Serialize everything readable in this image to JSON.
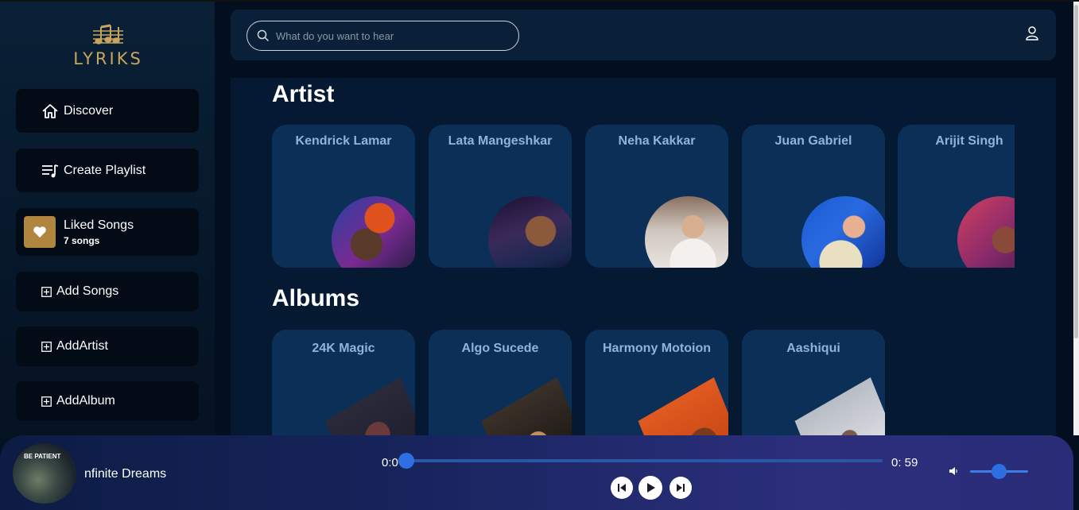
{
  "app": {
    "logo_text": "LYRIKS"
  },
  "sidebar": {
    "discover": "Discover",
    "create_playlist": "Create Playlist",
    "liked_title": "Liked Songs",
    "liked_count": "7 songs",
    "add_songs": "Add Songs",
    "add_artist": "AddArtist",
    "add_album": "AddAlbum"
  },
  "search": {
    "placeholder": "What do you want to hear"
  },
  "artists_section": {
    "title": "Artist",
    "items": [
      {
        "name": "Kendrick Lamar"
      },
      {
        "name": "Lata Mangeshkar"
      },
      {
        "name": "Neha Kakkar"
      },
      {
        "name": "Juan Gabriel"
      },
      {
        "name": "Arijit Singh"
      }
    ]
  },
  "albums_section": {
    "title": "Albums",
    "items": [
      {
        "name": "24K Magic"
      },
      {
        "name": "Algo Sucede"
      },
      {
        "name": "Harmony Motoion"
      },
      {
        "name": "Aashiqui"
      }
    ]
  },
  "player": {
    "track": "nfinite Dreams",
    "thumb_label": "BE PATIENT",
    "current_time": "0:0",
    "total_time": "0: 59",
    "progress": 0,
    "volume": 0.5
  },
  "colors": {
    "accent": "#2d6fe0",
    "card": "#0b2f57",
    "gold": "#c9a45c"
  }
}
